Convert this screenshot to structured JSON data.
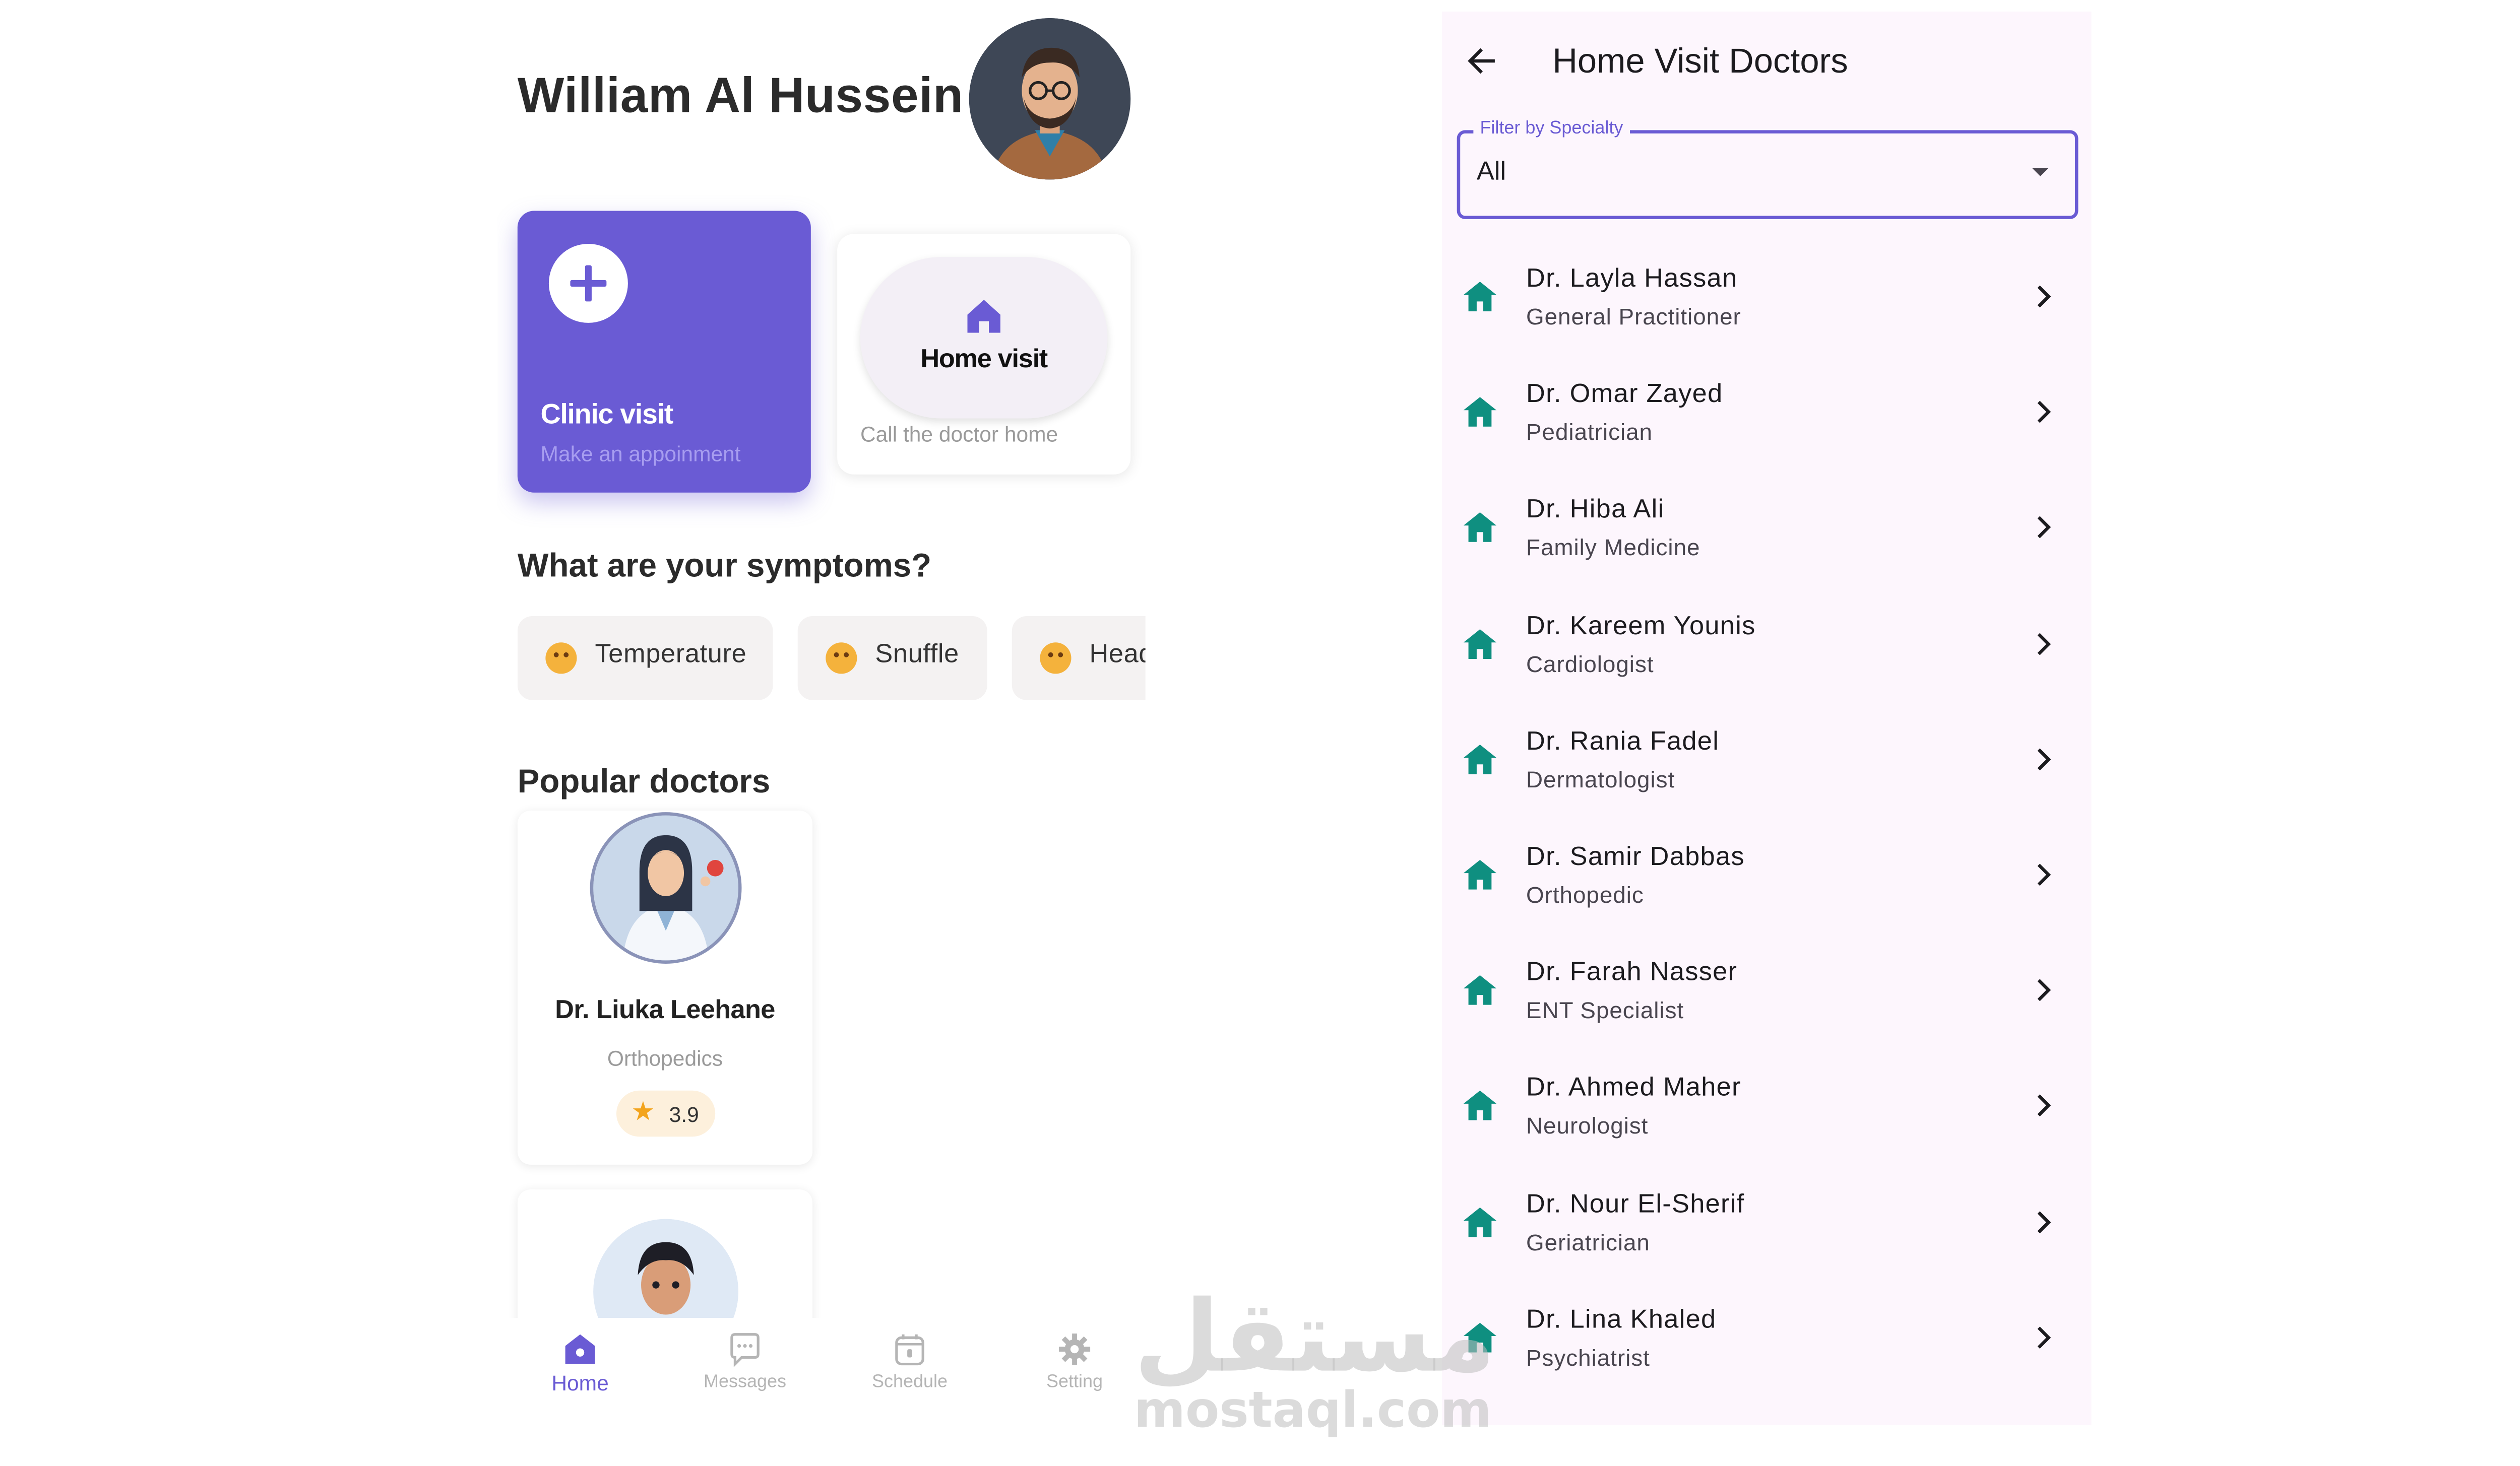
{
  "home_screen": {
    "user_name": "William Al Hussein",
    "clinic_card": {
      "title": "Clinic visit",
      "subtitle": "Make an appoinment"
    },
    "home_card": {
      "title": "Home visit",
      "subtitle": "Call the doctor home"
    },
    "symptoms_title": "What are your symptoms?",
    "symptoms": [
      {
        "label": "Temperature",
        "icon": "feverish-face-emoji"
      },
      {
        "label": "Snuffle",
        "icon": "sneezing-face-emoji"
      },
      {
        "label": "Headache",
        "icon": "headache-face-emoji"
      }
    ],
    "popular_title": "Popular doctors",
    "popular_doctors": [
      {
        "name": "Dr. Liuka Leehane",
        "specialty": "Orthopedics",
        "rating": "3.9"
      }
    ],
    "bottom_nav": [
      {
        "label": "Home",
        "icon": "home-icon",
        "active": true
      },
      {
        "label": "Messages",
        "icon": "chat-bubble-icon",
        "active": false
      },
      {
        "label": "Schedule",
        "icon": "calendar-icon",
        "active": false
      },
      {
        "label": "Setting",
        "icon": "gear-icon",
        "active": false
      }
    ]
  },
  "doctors_screen": {
    "title": "Home Visit Doctors",
    "filter": {
      "label": "Filter by Specialty",
      "value": "All"
    },
    "doctors": [
      {
        "name": "Dr. Layla Hassan",
        "specialty": "General Practitioner"
      },
      {
        "name": "Dr. Omar Zayed",
        "specialty": "Pediatrician"
      },
      {
        "name": "Dr. Hiba Ali",
        "specialty": "Family Medicine"
      },
      {
        "name": "Dr. Kareem Younis",
        "specialty": "Cardiologist"
      },
      {
        "name": "Dr. Rania Fadel",
        "specialty": "Dermatologist"
      },
      {
        "name": "Dr. Samir Dabbas",
        "specialty": "Orthopedic"
      },
      {
        "name": "Dr. Farah Nasser",
        "specialty": "ENT Specialist"
      },
      {
        "name": "Dr. Ahmed Maher",
        "specialty": "Neurologist"
      },
      {
        "name": "Dr. Nour El-Sherif",
        "specialty": "Geriatrician"
      },
      {
        "name": "Dr. Lina Khaled",
        "specialty": "Psychiatrist"
      }
    ]
  },
  "watermark": {
    "arabic": "مستقل",
    "latin": "mostaql.com"
  },
  "colors": {
    "primary": "#6a5bd4",
    "teal_icon": "#0f8f80",
    "right_background": "#fdf6fd",
    "chip_background": "#f4f2f2",
    "rating_star": "#f3a41c"
  }
}
